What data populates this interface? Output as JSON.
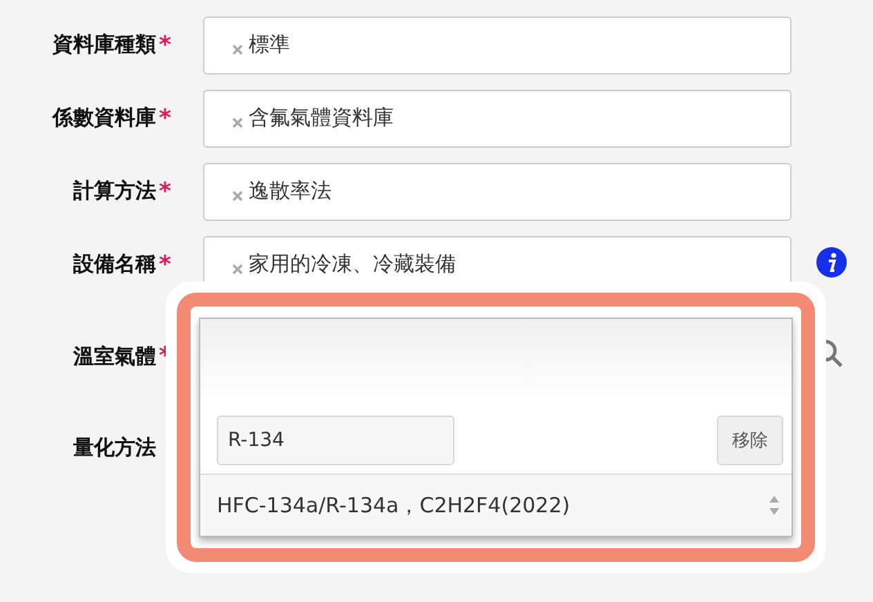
{
  "fields": [
    {
      "kind": "tag",
      "label": "資料庫種類",
      "required_mark": "*",
      "value": "標準"
    },
    {
      "kind": "tag",
      "label": "係數資料庫",
      "required_mark": "*",
      "value": "含氟氣體資料庫"
    },
    {
      "kind": "tag",
      "label": "計算方法",
      "required_mark": "*",
      "value": "逸散率法"
    },
    {
      "kind": "tag_info",
      "label": "設備名稱",
      "required_mark": "*",
      "value": "家用的冷凍、冷藏裝備"
    },
    {
      "kind": "search",
      "label": "溫室氣體",
      "required_mark": "*"
    },
    {
      "kind": "plain",
      "label": "量化方法"
    }
  ],
  "popup": {
    "search_value": "R-134",
    "remove_button": "移除",
    "select_value": "HFC-134a/R-134a，C2H2F4(2022)"
  }
}
